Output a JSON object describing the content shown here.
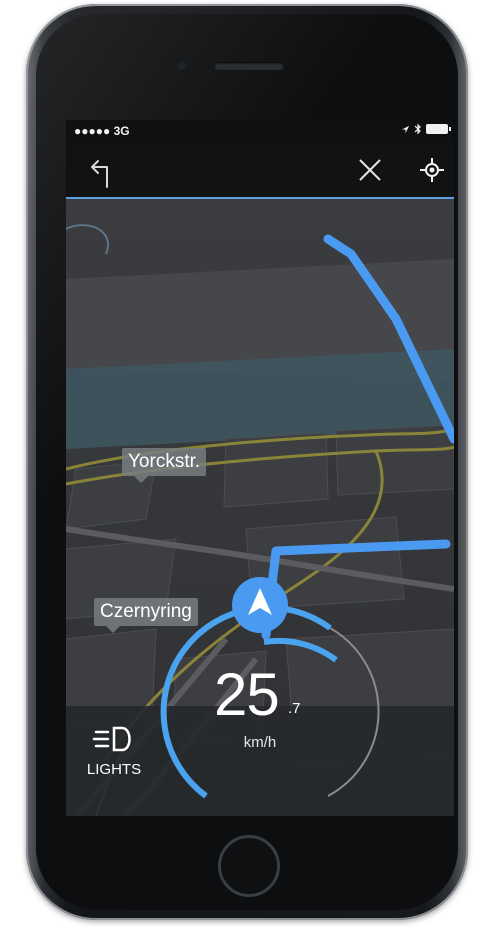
{
  "status_bar": {
    "carrier": "●●●●● 3G"
  },
  "navbar": {
    "turn_icon": "turn-left-arrow",
    "close_icon": "close-x",
    "locate_icon": "crosshair-locate"
  },
  "map": {
    "street_labels": [
      {
        "text": "Yorckstr."
      },
      {
        "text": "Czernyring"
      }
    ],
    "route_color": "#4a9af2",
    "water_color": "#3f5560"
  },
  "speedometer": {
    "speed_whole": "25",
    "speed_decimal": ".7",
    "unit": "km/h",
    "arc_color": "#4aa3ef"
  },
  "lights": {
    "label": "LIGHTS",
    "icon": "headlight-icon"
  }
}
